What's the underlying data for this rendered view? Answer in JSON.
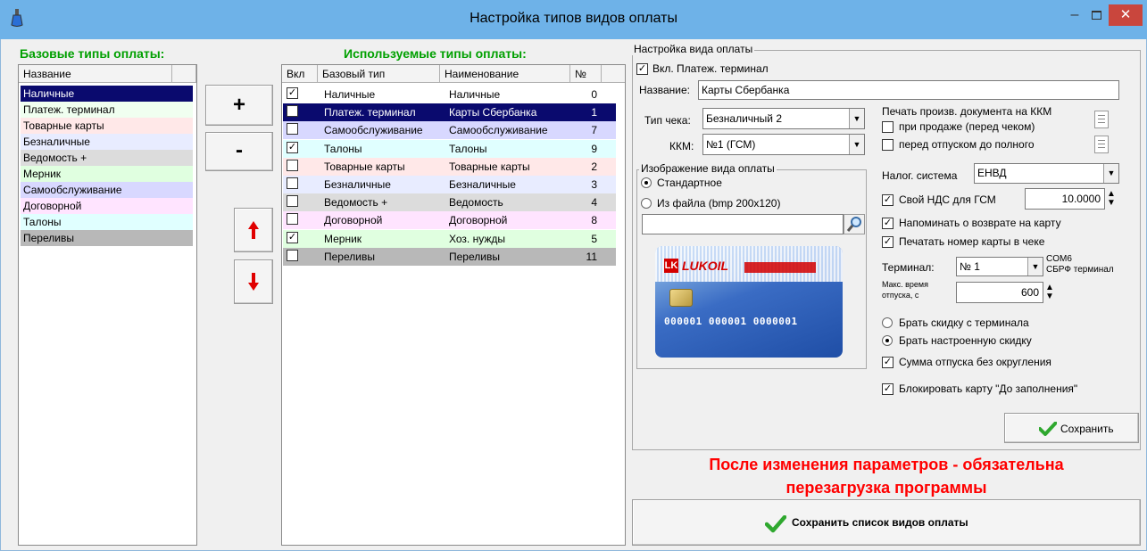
{
  "window": {
    "title": "Настройка типов видов оплаты",
    "minimize": "–",
    "close": "✕"
  },
  "base": {
    "title": "Базовые типы оплаты:",
    "column": "Название",
    "items": [
      "Наличные",
      "Платеж. терминал",
      "Товарные карты",
      "Безналичные",
      "Ведомость +",
      "Мерник",
      "Самообслуживание",
      "Договорной",
      "Талоны",
      "Переливы"
    ],
    "colors": [
      "#0a0a6e",
      "#f0fff0",
      "#ffe8e8",
      "#e8ecff",
      "#dcdcdc",
      "#e0ffe0",
      "#d8d8ff",
      "#ffe4ff",
      "#e0ffff",
      "#b8b8b8"
    ]
  },
  "buttons": {
    "add": "+",
    "remove": "-",
    "up": "▲",
    "down": "▼"
  },
  "used": {
    "title": "Используемые типы оплаты:",
    "headers": {
      "on": "Вкл",
      "base": "Базовый тип",
      "name": "Наименование",
      "num": "№"
    },
    "rows": [
      {
        "on": true,
        "base": "Наличные",
        "name": "Наличные",
        "num": "0"
      },
      {
        "on": true,
        "base": "Платеж. терминал",
        "name": "Карты Сбербанка",
        "num": "1"
      },
      {
        "on": false,
        "base": "Самообслуживание",
        "name": "Самообслуживание",
        "num": "7"
      },
      {
        "on": true,
        "base": "Талоны",
        "name": "Талоны",
        "num": "9"
      },
      {
        "on": false,
        "base": "Товарные карты",
        "name": "Товарные карты",
        "num": "2"
      },
      {
        "on": false,
        "base": "Безналичные",
        "name": "Безналичные",
        "num": "3"
      },
      {
        "on": false,
        "base": "Ведомость +",
        "name": "Ведомость",
        "num": "4"
      },
      {
        "on": false,
        "base": "Договорной",
        "name": "Договорной",
        "num": "8"
      },
      {
        "on": true,
        "base": "Мерник",
        "name": "Хоз. нужды",
        "num": "5"
      },
      {
        "on": false,
        "base": "Переливы",
        "name": "Переливы",
        "num": "11"
      }
    ],
    "colors": [
      "#ffffff",
      "#0a0a6e",
      "#d8d8ff",
      "#e0ffff",
      "#ffe8e8",
      "#e8ecff",
      "#dcdcdc",
      "#ffe4ff",
      "#e0ffe0",
      "#b8b8b8"
    ]
  },
  "settings": {
    "group_title": "Настройка вида оплаты",
    "enable_terminal": "Вкл. Платеж. терминал",
    "name_label": "Название:",
    "name_value": "Карты Сбербанка",
    "check_type_label": "Тип чека:",
    "check_type_value": "Безналичный 2",
    "kkm_label": "ККМ:",
    "kkm_value": "№1 (ГСМ)",
    "print_doc_title": "Печать произв. документа на ККМ",
    "print_on_sale": "при продаже (перед чеком)",
    "print_before_full": "перед отпуском до полного",
    "image_group_title": "Изображение вида оплаты",
    "radio_standard": "Стандартное",
    "radio_file": "Из файла (bmp 200x120)",
    "file_value": "",
    "tax_label": "Налог. система",
    "tax_value": "ЕНВД",
    "own_vat": "Свой НДС для ГСМ",
    "own_vat_value": "10.0000",
    "remind_return": "Напоминать о возврате на карту",
    "print_card_num": "Печатать номер карты в чеке",
    "terminal_label": "Терминал:",
    "terminal_value": "№ 1",
    "terminal_port": "COM6",
    "terminal_type": "СБРФ терминал",
    "max_time_label_1": "Макс. время",
    "max_time_label_2": "отпуска, с",
    "max_time_value": "600",
    "radio_discount_terminal": "Брать скидку с терминала",
    "radio_discount_configured": "Брать настроенную скидку",
    "sum_no_round": "Сумма отпуска без округления",
    "block_card": "Блокировать карту \"До заполнения\"",
    "save": "Сохранить"
  },
  "card": {
    "brand": "LUKOIL",
    "number": "000001 000001 0000001",
    "brand_color": "#d40000",
    "bg": "#2a56b0"
  },
  "warning": {
    "line1": "После изменения параметров - обязательна",
    "line2": "перезагрузка программы"
  },
  "save_list": "Сохранить список видов оплаты"
}
